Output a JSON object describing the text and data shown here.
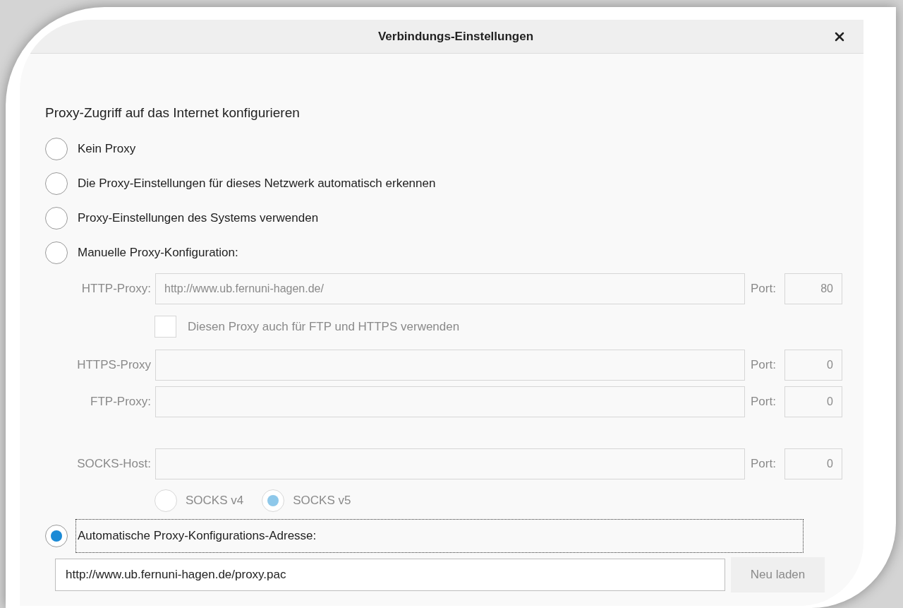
{
  "dialog": {
    "title": "Verbindungs-Einstellungen"
  },
  "section_title": "Proxy-Zugriff auf das Internet konfigurieren",
  "modes": [
    {
      "label": "Kein Proxy",
      "selected": false,
      "focused": false
    },
    {
      "label": "Die Proxy-Einstellungen für dieses Netzwerk automatisch erkennen",
      "selected": false,
      "focused": false
    },
    {
      "label": "Proxy-Einstellungen des Systems verwenden",
      "selected": false,
      "focused": false
    },
    {
      "label": "Manuelle Proxy-Konfiguration:",
      "selected": false,
      "focused": false,
      "disabled": true,
      "proxies": [
        {
          "label": "HTTP-Proxy:",
          "value": "http://www.ub.fernuni-hagen.de/",
          "port_label": "Port:",
          "port": "80",
          "share": {
            "label": "Diesen Proxy auch für FTP und HTTPS verwenden",
            "checked": false
          }
        },
        {
          "label": "HTTPS-Proxy",
          "port_label": "Port:",
          "port": "0"
        },
        {
          "label": "FTP-Proxy:",
          "port_label": "Port:",
          "port": "0"
        },
        {
          "label": "SOCKS-Host:",
          "port_label": "Port:",
          "port": "0",
          "versions": [
            {
              "label": "SOCKS v4",
              "selected": false
            },
            {
              "label": "SOCKS v5",
              "selected": true
            }
          ]
        }
      ]
    },
    {
      "label": "Automatische Proxy-Konfigurations-Adresse:",
      "selected": true,
      "focused": true,
      "config_url": {
        "value": "http://www.ub.fernuni-hagen.de/proxy.pac",
        "button": "Neu laden",
        "button_disabled": true
      }
    }
  ]
}
